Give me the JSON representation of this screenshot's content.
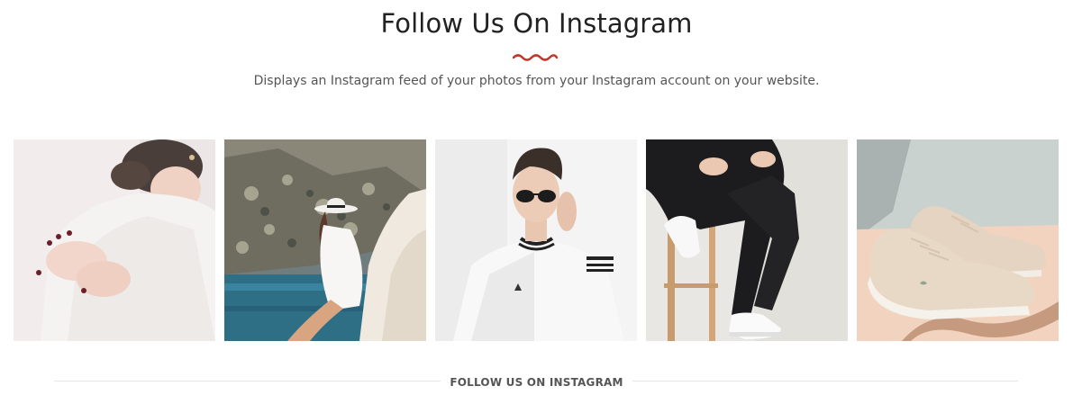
{
  "section": {
    "title": "Follow Us On Instagram",
    "subtitle": "Displays an Instagram feed of your photos from your Instagram account on your website.",
    "accent_color": "#c0392b"
  },
  "gallery": {
    "tiles": [
      {
        "subject": "woman in white sweater"
      },
      {
        "subject": "woman in white hat on rocks"
      },
      {
        "subject": "man with sunglasses in white jacket"
      },
      {
        "subject": "legs in black jeans and white sneakers"
      },
      {
        "subject": "beige sneakers on peach background"
      }
    ]
  },
  "footer": {
    "label": "FOLLOW US ON INSTAGRAM"
  }
}
